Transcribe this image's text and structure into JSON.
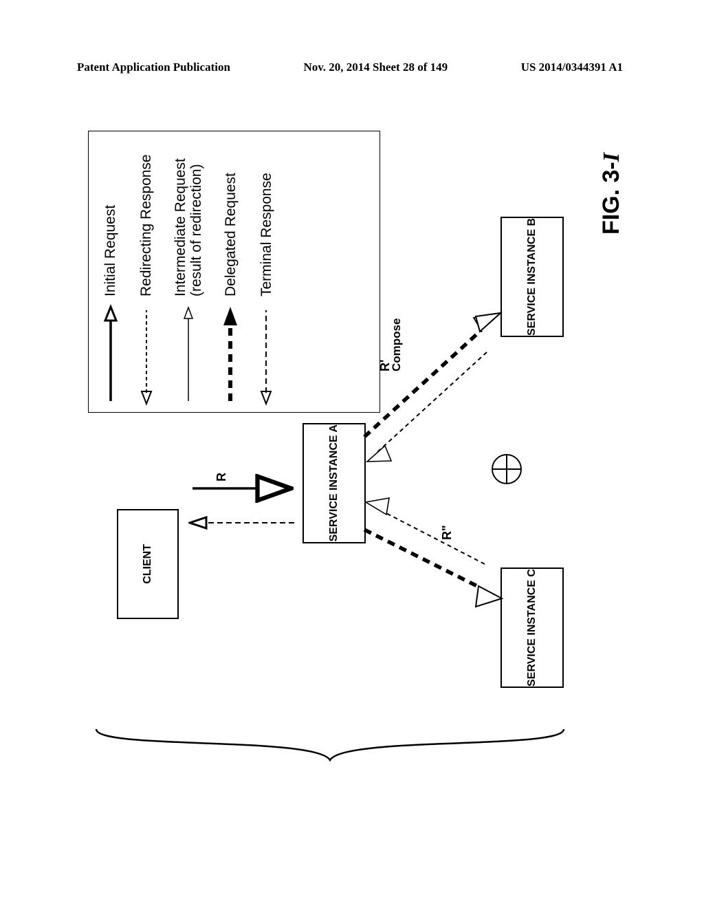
{
  "header": {
    "left": "Patent Application Publication",
    "center": "Nov. 20, 2014  Sheet 28 of 149",
    "right": "US 2014/0344391 A1"
  },
  "figure": {
    "title_prefix": "FIG. 3-",
    "title_suffix": "I"
  },
  "legend": {
    "items": [
      {
        "label": "Initial Request",
        "style": "solid-open"
      },
      {
        "label": "Redirecting Response",
        "style": "dash-open-back"
      },
      {
        "label": "Intermediate Request (result of redirection)",
        "style": "thin-open"
      },
      {
        "label": "Delegated Request",
        "style": "heavy-dash-solid"
      },
      {
        "label": "Terminal Response",
        "style": "long-dash-open-back"
      }
    ]
  },
  "diagram": {
    "client": "CLIENT",
    "service_a": "SERVICE INSTANCE A",
    "service_b": "SERVICE INSTANCE B",
    "service_c": "SERVICE INSTANCE C",
    "compose": "Compose",
    "R": "R",
    "Rp": "R'",
    "Rpp": "R\""
  }
}
